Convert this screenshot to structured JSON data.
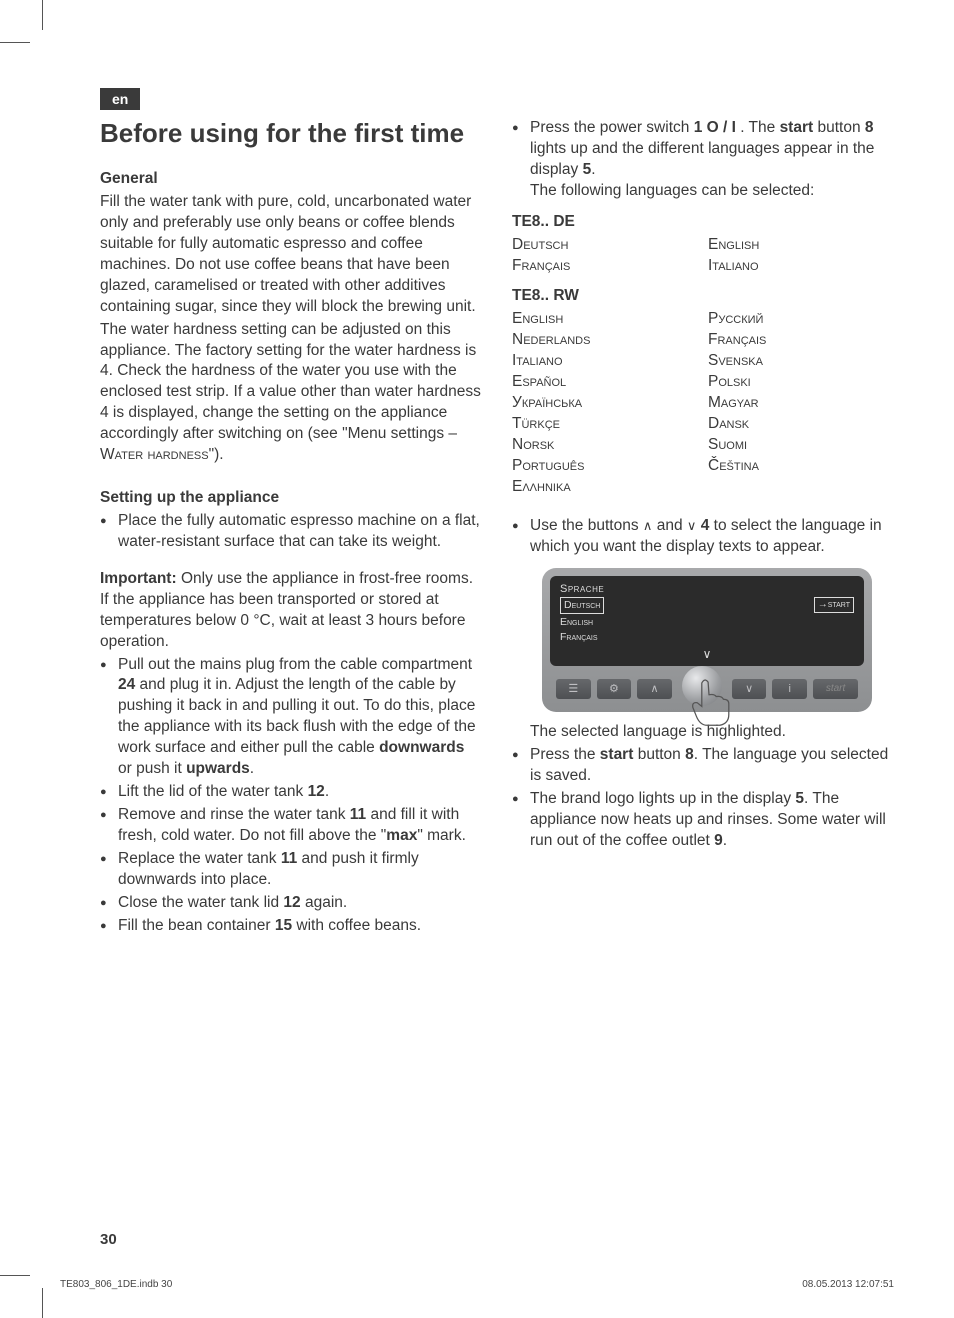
{
  "langTab": "en",
  "title": "Before using for the first time",
  "left": {
    "generalHead": "General",
    "generalP1": "Fill the water tank with pure, cold, uncarbonated water only and preferably use only beans or coffee blends suitable for fully automatic espresso and coffee machines. Do not use coffee beans that have been glazed, caramelised or treated with other additives containing sugar, since they will block the brewing unit.",
    "generalP2a": "The water hardness setting can be adjusted on this appliance. The factory setting for the water hardness is 4. Check the hardness of the water you use with the enclosed test strip. If a value other than water hardness 4 is displayed, change the setting on the appliance accordingly after switching on (see \"Menu settings – ",
    "generalP2sc": "Water hardness",
    "generalP2b": "\").",
    "setupHead": "Setting up the appliance",
    "setupItem1": "Place the fully automatic espresso machine on a flat, water-resistant surface that can take its weight.",
    "importantLabel": "Important:",
    "importantText": " Only use the appliance in frost-free rooms. If the appliance has been transported or stored at temperatures below 0 °C, wait at least 3 hours before operation.",
    "li_plug_a": "Pull out the mains plug from the cable compartment ",
    "li_plug_b": " and plug it in. Adjust the length of the cable by pushing it back in and pulling it out. To do this, place the appliance with its back flush with the edge of the work surface and either pull the cable ",
    "li_plug_c": " or push it ",
    "li_plug_d": ".",
    "n24": "24",
    "downwards": "downwards",
    "upwards": "upwards",
    "li_liftlid_a": "Lift the lid of the water tank ",
    "li_liftlid_b": ".",
    "n12": "12",
    "li_rinse_a": "Remove and rinse the water tank ",
    "li_rinse_b": " and fill it with fresh, cold water. Do not fill above the \"",
    "li_rinse_c": "\" mark.",
    "n11": "11",
    "max": "max",
    "li_replace_a": "Replace the water tank ",
    "li_replace_b": " and push it firmly downwards into place.",
    "li_closelid_a": "Close the water tank lid ",
    "li_closelid_b": " again.",
    "li_beans_a": "Fill the bean container ",
    "li_beans_b": " with coffee beans.",
    "n15": "15"
  },
  "right": {
    "li_power_a": "Press the power switch ",
    "li_power_b": " . The ",
    "li_power_c": " button ",
    "li_power_d": " lights up and the different languages appear in the display ",
    "li_power_e": ".",
    "oneOI": "1 O / I",
    "startWord": "start",
    "n8": "8",
    "n5": "5",
    "followLine": "The following languages can be selected:",
    "modelDE": "TE8.. DE",
    "deLangs": [
      "Deutsch",
      "English",
      "Français",
      "Italiano"
    ],
    "modelRW": "TE8.. RW",
    "rwLangs": [
      "English",
      "Русский",
      "Nederlands",
      "Français",
      "Italiano",
      "Svenska",
      "Español",
      "Polski",
      "Українська",
      "Magyar",
      "Türkçe",
      "Dansk",
      "Norsk",
      "Suomi",
      "Português",
      "Čeština",
      "Ελληνικα",
      ""
    ],
    "li_select_a": "Use the buttons ",
    "li_select_b": " and ",
    "li_select_c": " ",
    "li_select_d": " to select the language in which you want the display texts to appear.",
    "n4": "4",
    "screen": {
      "title": "Sprache",
      "selected": "Deutsch",
      "startLabel": "start",
      "opt1": "English",
      "opt2": "Français",
      "btnStart": "start"
    },
    "afterFig1": "The selected language is highlighted.",
    "li_pressStart_a": "Press the ",
    "li_pressStart_b": " button ",
    "li_pressStart_c": ". The language you selected is saved.",
    "li_brand_a": "The brand logo lights up in the display ",
    "li_brand_b": ". The appliance now heats up and rinses. Some water will run out of the coffee outlet ",
    "li_brand_c": ".",
    "n9": "9"
  },
  "pageNumber": "30",
  "printFile": "TE803_806_1DE.indb   30",
  "printDate": "08.05.2013   12:07:51"
}
